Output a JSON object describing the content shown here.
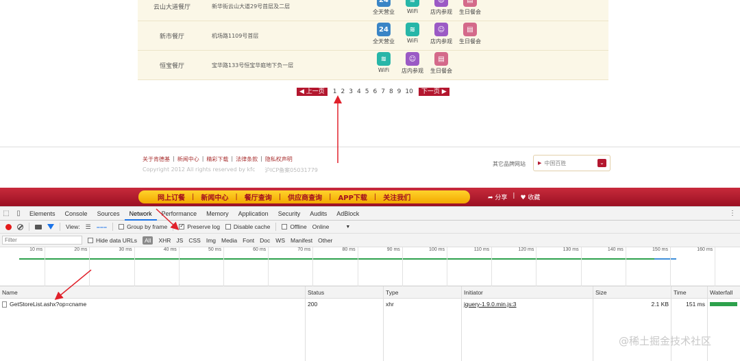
{
  "stores": [
    {
      "name": "云山大道餐厅",
      "address": "新华街云山大道29号首层及二层",
      "services": [
        "全天营业",
        "WiFi",
        "店内参观",
        "生日餐会"
      ],
      "icons": [
        "24h-icon",
        "wifi-icon",
        "room-icon",
        "cake-icon"
      ]
    },
    {
      "name": "新市餐厅",
      "address": "机场路1109号首层",
      "services": [
        "全天营业",
        "WiFi",
        "店内参观",
        "生日餐会"
      ],
      "icons": [
        "24h-icon",
        "wifi-icon",
        "room-icon",
        "cake-icon"
      ]
    },
    {
      "name": "恒宝餐厅",
      "address": "宝华路133号恒宝华庭地下负一层",
      "services": [
        "WiFi",
        "店内参观",
        "生日餐会"
      ],
      "icons": [
        "wifi-icon",
        "room-icon",
        "cake-icon"
      ]
    }
  ],
  "pagination": {
    "prev": "◀ 上一页",
    "next": "下一页 ▶",
    "pages": [
      "1",
      "2",
      "3",
      "4",
      "5",
      "6",
      "7",
      "8",
      "9",
      "10"
    ]
  },
  "footer": {
    "links": [
      "关于肯德基",
      "新闻中心",
      "精彩下载",
      "法律条款",
      "隐私权声明"
    ],
    "separator": "|",
    "copyright": "Copyright 2012 All rights reserved by kfc",
    "icp": "沪ICP备案05031779",
    "brand_label": "其它品牌网站",
    "brand_value": "中国百胜"
  },
  "nav": {
    "items": [
      "网上订餐",
      "新闻中心",
      "餐厅查询",
      "供应商查询",
      "APP下载",
      "关注我们"
    ],
    "separator": "|",
    "share": "➦ 分享",
    "share_sep": "|",
    "favorite": "♥ 收藏"
  },
  "devtools": {
    "tabs": [
      "Elements",
      "Console",
      "Sources",
      "Network",
      "Performance",
      "Memory",
      "Application",
      "Security",
      "Audits",
      "AdBlock"
    ],
    "active_tab": "Network",
    "toolbar": {
      "view_label": "View:",
      "group_by_frame": "Group by frame",
      "preserve_log": "Preserve log",
      "disable_cache": "Disable cache",
      "offline": "Offline",
      "throttle": "Online"
    },
    "filter": {
      "placeholder": "Filter",
      "hide_data_urls": "Hide data URLs",
      "types": [
        "All",
        "XHR",
        "JS",
        "CSS",
        "Img",
        "Media",
        "Font",
        "Doc",
        "WS",
        "Manifest",
        "Other"
      ]
    },
    "timeline_ticks": [
      "10 ms",
      "20 ms",
      "30 ms",
      "40 ms",
      "50 ms",
      "60 ms",
      "70 ms",
      "80 ms",
      "90 ms",
      "100 ms",
      "110 ms",
      "120 ms",
      "130 ms",
      "140 ms",
      "150 ms",
      "160 ms"
    ],
    "columns": {
      "name": "Name",
      "status": "Status",
      "type": "Type",
      "initiator": "Initiator",
      "size": "Size",
      "time": "Time",
      "waterfall": "Waterfall"
    },
    "rows": [
      {
        "name": "GetStoreList.ashx?op=cname",
        "status": "200",
        "type": "xhr",
        "initiator": "jquery-1.9.0.min.js:3",
        "size": "2.1 KB",
        "time": "151 ms"
      }
    ]
  },
  "watermark": "@稀土掘金技术社区",
  "colors": {
    "brand_red": "#b3172f",
    "nav_yellow": "#ffd32b",
    "devtools_blue": "#1a73e8",
    "annotation_red": "#e0212b"
  }
}
